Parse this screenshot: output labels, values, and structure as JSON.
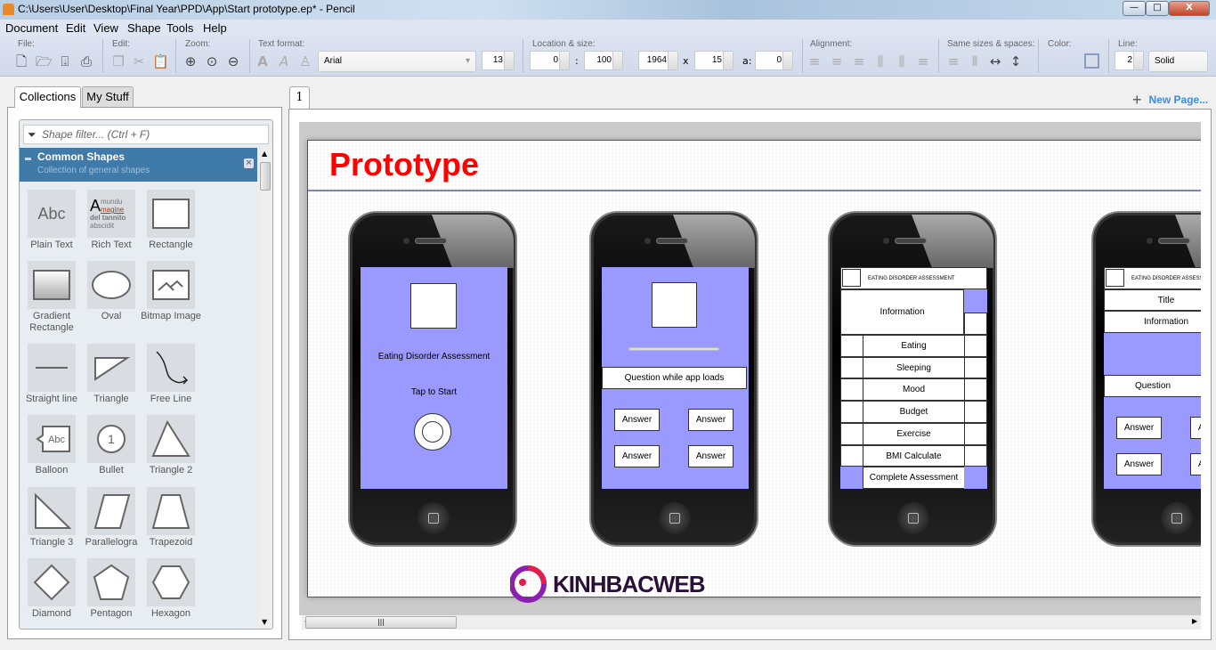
{
  "window": {
    "title": "C:\\Users\\User\\Desktop\\Final Year\\PPD\\App\\Start prototype.ep* - Pencil",
    "minimize": "—",
    "maximize": "□",
    "close": "X"
  },
  "menu": [
    "Document",
    "Edit",
    "View",
    "Shape",
    "Tools",
    "Help"
  ],
  "toolbar": {
    "groups": {
      "file": "File:",
      "edit": "Edit:",
      "zoom": "Zoom:",
      "text_format": "Text format:",
      "location_size": "Location & size:",
      "alignment": "Alignment:",
      "same_sizes": "Same sizes & spaces:",
      "color": "Color:",
      "line": "Line:"
    },
    "font": "Arial",
    "font_size": "13",
    "x": "0",
    "y": "100",
    "width": "1964",
    "height": "15",
    "angle": "0",
    "x_sep": ":",
    "size_sep": "x",
    "angle_label": "a:",
    "line_width": "2",
    "line_style": "Solid"
  },
  "left_panel": {
    "tabs": [
      "Collections",
      "My Stuff"
    ],
    "filter_placeholder": "Shape filter... (Ctrl + F)",
    "collection": {
      "name": "Common Shapes",
      "description": "Collection of general shapes"
    },
    "shapes": [
      {
        "label": "Plain Text",
        "icon": "plain-text"
      },
      {
        "label": "Rich Text",
        "icon": "rich-text"
      },
      {
        "label": "Rectangle",
        "icon": "rectangle"
      },
      {
        "label": "Gradient Rectangle",
        "icon": "gradient-rectangle"
      },
      {
        "label": "Oval",
        "icon": "oval"
      },
      {
        "label": "Bitmap Image",
        "icon": "bitmap-image"
      },
      {
        "label": "Straight line",
        "icon": "straight-line"
      },
      {
        "label": "Triangle",
        "icon": "triangle"
      },
      {
        "label": "Free Line",
        "icon": "free-line"
      },
      {
        "label": "Balloon",
        "icon": "balloon"
      },
      {
        "label": "Bullet",
        "icon": "bullet"
      },
      {
        "label": "Triangle 2",
        "icon": "triangle-2"
      },
      {
        "label": "Triangle 3",
        "icon": "triangle-3"
      },
      {
        "label": "Parallelogra",
        "icon": "parallelogram"
      },
      {
        "label": "Trapezoid",
        "icon": "trapezoid"
      },
      {
        "label": "Diamond",
        "icon": "diamond"
      },
      {
        "label": "Pentagon",
        "icon": "pentagon"
      },
      {
        "label": "Hexagon",
        "icon": "hexagon"
      }
    ],
    "icon_text": {
      "abc": "Abc",
      "rich_a": "A",
      "rich_1": "mundu",
      "rich_2": "magine",
      "rich_3": "del tannito",
      "rich_4": "abscidit",
      "bullet": "1"
    }
  },
  "pages": {
    "tab": "1",
    "new_page": "New Page..."
  },
  "canvas": {
    "title": "Prototype",
    "colors": {
      "title": "#ff0000",
      "screen": "#9999ff",
      "rule": "#7a86c2"
    },
    "phone1": {
      "title": "Eating Disorder Assessment",
      "tap": "Tap to Start"
    },
    "phone2": {
      "question": "Question while app loads",
      "answers": [
        "Answer",
        "Answer",
        "Answer",
        "Answer"
      ]
    },
    "phone3": {
      "header": "EATING DISORDER ASSESSMENT",
      "info": "Information",
      "items": [
        "Eating",
        "Sleeping",
        "Mood",
        "Budget",
        "Exercise",
        "BMI Calculate",
        "Complete Assessment"
      ]
    },
    "phone4": {
      "header": "EATING DISORDER ASSESSMENT",
      "title": "Title",
      "info": "Information",
      "question": "Question",
      "answers": [
        "Answer",
        "Answer",
        "Answer",
        "Answer"
      ]
    }
  },
  "watermark": "KINHBACWEB"
}
